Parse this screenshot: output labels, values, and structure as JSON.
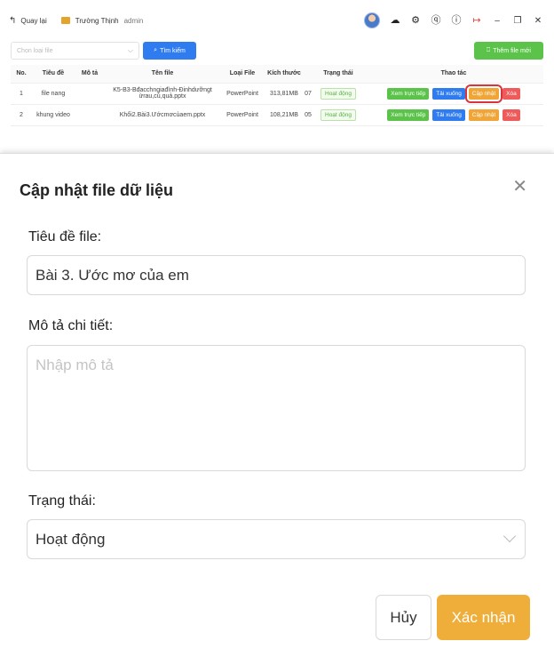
{
  "topbar": {
    "back_label": "Quay lại",
    "user_name": "Trường Thịnh",
    "user_role": "admin"
  },
  "filter": {
    "file_type_placeholder": "Chọn loại file",
    "search_label": "Tìm kiếm",
    "add_label": "Thêm file mới"
  },
  "table": {
    "headers": [
      "No.",
      "Tiêu đề",
      "Mô tả",
      "Tên file",
      "Loại File",
      "Kích thước",
      "",
      "Trạng thái",
      "Thao tác"
    ],
    "rows": [
      {
        "no": "1",
        "title": "file nang",
        "desc": "",
        "filename_line1": "K5-B3-Bđacchngiađình-Đinhdưỡngt",
        "filename_line2": "ừrau,củ,quả.pptx",
        "type": "PowerPoint",
        "size": "313,81MB",
        "extra": "07",
        "status": "Hoạt động"
      },
      {
        "no": "2",
        "title": "khung video",
        "desc": "",
        "filename_line1": "Khổi2.Bài3.Ướcmơcủaem.pptx",
        "filename_line2": "",
        "type": "PowerPoint",
        "size": "108,21MB",
        "extra": "05",
        "status": "Hoạt động"
      }
    ],
    "actions": {
      "view": "Xem trực tiếp",
      "download": "Tải xuống",
      "update": "Cập nhật",
      "delete": "Xóa"
    }
  },
  "modal": {
    "title": "Cập nhật file dữ liệu",
    "title_label": "Tiêu đề file:",
    "title_value": "Bài 3. Ước mơ của em",
    "desc_label": "Mô tả chi tiết:",
    "desc_placeholder": "Nhập mô tả",
    "status_label": "Trạng thái:",
    "status_value": "Hoạt động",
    "cancel_label": "Hủy",
    "confirm_label": "Xác nhận"
  },
  "colors": {
    "primary_blue": "#2f7bf0",
    "success_green": "#5bc34a",
    "warning_orange": "#efae3a",
    "danger_red": "#ef5a5a",
    "highlight_red": "#d9343a"
  },
  "icons": {
    "back": "arrow-left-icon",
    "folder": "book-icon",
    "download": "cloud-download-icon",
    "settings": "gear-icon",
    "help": "question-icon",
    "info": "info-icon",
    "logout": "logout-icon",
    "minimize": "minimize-icon",
    "restore": "restore-icon",
    "close": "close-icon"
  }
}
